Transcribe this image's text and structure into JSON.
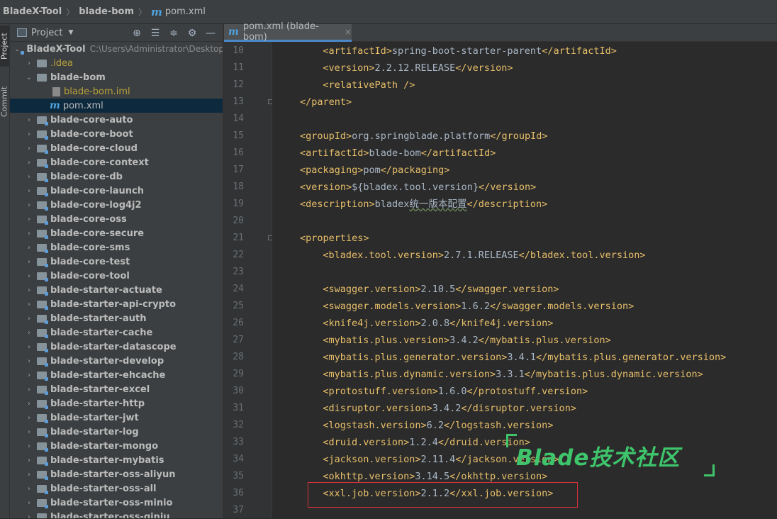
{
  "breadcrumb": {
    "project": "BladeX-Tool",
    "module": "blade-bom",
    "file": "pom.xml"
  },
  "side_stripe": {
    "project_tab": "Project",
    "commit_tab": "Commit"
  },
  "project_panel": {
    "title": "Project",
    "tool_icons": [
      "locate-icon",
      "expand-all-icon",
      "collapse-all-icon",
      "gear-icon",
      "hide-icon"
    ]
  },
  "tree": {
    "root": {
      "label": "BladeX-Tool",
      "path": "C:\\Users\\Administrator\\Desktop"
    },
    "idea": ".idea",
    "bom": {
      "label": "blade-bom",
      "iml": "blade-bom.iml",
      "pom": "pom.xml"
    },
    "modules": [
      "blade-core-auto",
      "blade-core-boot",
      "blade-core-cloud",
      "blade-core-context",
      "blade-core-db",
      "blade-core-launch",
      "blade-core-log4j2",
      "blade-core-oss",
      "blade-core-secure",
      "blade-core-sms",
      "blade-core-test",
      "blade-core-tool",
      "blade-starter-actuate",
      "blade-starter-api-crypto",
      "blade-starter-auth",
      "blade-starter-cache",
      "blade-starter-datascope",
      "blade-starter-develop",
      "blade-starter-ehcache",
      "blade-starter-excel",
      "blade-starter-http",
      "blade-starter-jwt",
      "blade-starter-log",
      "blade-starter-mongo",
      "blade-starter-mybatis",
      "blade-starter-oss-aliyun",
      "blade-starter-oss-all",
      "blade-starter-oss-minio",
      "blade-starter-oss-qiniu"
    ]
  },
  "editor_tab": {
    "label": "pom.xml (blade-bom)",
    "close": "×"
  },
  "code_lines": [
    {
      "n": "10",
      "indent": 2,
      "tag": "artifactId",
      "value": "spring-boot-starter-parent"
    },
    {
      "n": "11",
      "indent": 2,
      "tag": "version",
      "value": "2.2.12.RELEASE"
    },
    {
      "n": "12",
      "indent": 2,
      "raw": "<relativePath />"
    },
    {
      "n": "13",
      "indent": 1,
      "raw": "</parent>",
      "fold": true
    },
    {
      "n": "14"
    },
    {
      "n": "15",
      "indent": 1,
      "tag": "groupId",
      "value": "org.springblade.platform"
    },
    {
      "n": "16",
      "indent": 1,
      "tag": "artifactId",
      "value": "blade-bom"
    },
    {
      "n": "17",
      "indent": 1,
      "tag": "packaging",
      "value": "pom"
    },
    {
      "n": "18",
      "indent": 1,
      "tag": "version",
      "value": "${bladex.tool.version}"
    },
    {
      "n": "19",
      "indent": 1,
      "tag": "description",
      "value_prefix": "bladex",
      "value_zh": "统一版本配置"
    },
    {
      "n": "20"
    },
    {
      "n": "21",
      "indent": 1,
      "raw": "<properties>",
      "fold": true
    },
    {
      "n": "22",
      "indent": 2,
      "tag": "bladex.tool.version",
      "value": "2.7.1.RELEASE"
    },
    {
      "n": "23"
    },
    {
      "n": "24",
      "indent": 2,
      "tag": "swagger.version",
      "value": "2.10.5"
    },
    {
      "n": "25",
      "indent": 2,
      "tag": "swagger.models.version",
      "value": "1.6.2"
    },
    {
      "n": "26",
      "indent": 2,
      "tag": "knife4j.version",
      "value": "2.0.8"
    },
    {
      "n": "27",
      "indent": 2,
      "tag": "mybatis.plus.version",
      "value": "3.4.2"
    },
    {
      "n": "28",
      "indent": 2,
      "tag": "mybatis.plus.generator.version",
      "value": "3.4.1"
    },
    {
      "n": "29",
      "indent": 2,
      "tag": "mybatis.plus.dynamic.version",
      "value": "3.3.1"
    },
    {
      "n": "30",
      "indent": 2,
      "tag": "protostuff.version",
      "value": "1.6.0"
    },
    {
      "n": "31",
      "indent": 2,
      "tag": "disruptor.version",
      "value": "3.4.2"
    },
    {
      "n": "32",
      "indent": 2,
      "tag": "logstash.version",
      "value": "6.2"
    },
    {
      "n": "33",
      "indent": 2,
      "tag": "druid.version",
      "value": "1.2.4"
    },
    {
      "n": "34",
      "indent": 2,
      "tag": "jackson.version",
      "value": "2.11.4"
    },
    {
      "n": "35",
      "indent": 2,
      "tag": "okhttp.version",
      "value": "3.14.5"
    },
    {
      "n": "36",
      "indent": 2,
      "tag": "xxl.job.version",
      "value": "2.1.2"
    },
    {
      "n": "37"
    }
  ],
  "watermark": {
    "text": "Blade技术社区"
  },
  "colors": {
    "tag": "#e8bf6a",
    "text": "#a9b7c6",
    "highlight_box": "#d6323a",
    "watermark": "#3ec56b"
  }
}
